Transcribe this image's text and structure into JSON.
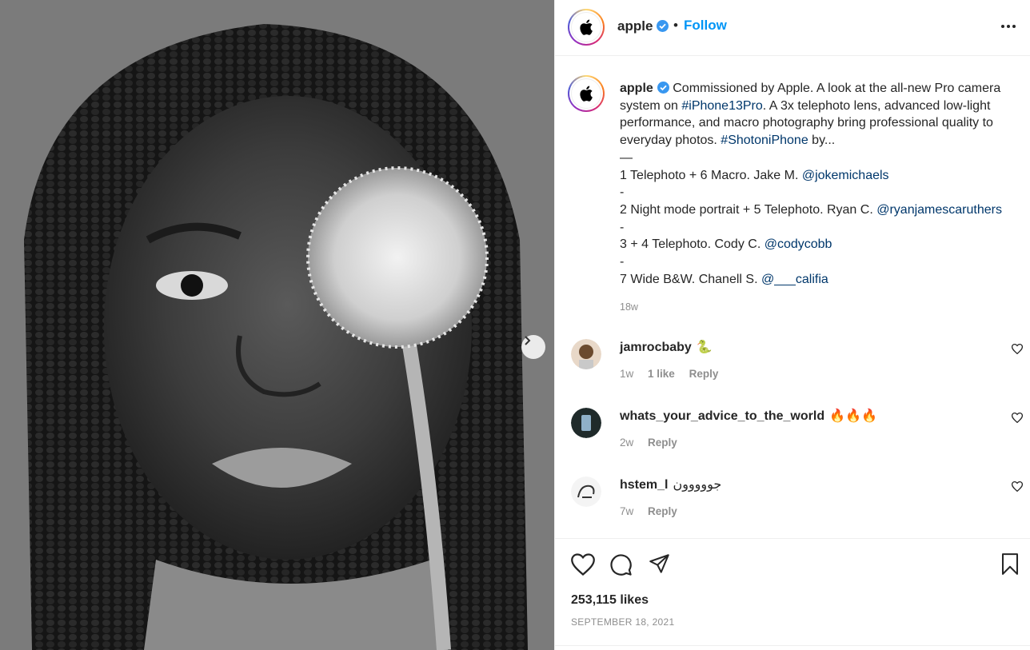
{
  "header": {
    "username": "apple",
    "separator": "•",
    "follow_label": "Follow"
  },
  "caption": {
    "username": "apple",
    "text_parts": {
      "p1": "Commissioned by Apple. A look at the all-new Pro camera system on ",
      "tag1": "#iPhone13Pro",
      "p2": ". A 3x telephoto lens, advanced low-light performance, and macro photography bring professional quality to everyday photos. ",
      "tag2": "#ShotoniPhone",
      "p3": " by..."
    },
    "lines": [
      {
        "text": "—",
        "mention": ""
      },
      {
        "text": "1 Telephoto + 6 Macro. Jake M. ",
        "mention": "@jokemichaels"
      },
      {
        "text": "-",
        "mention": ""
      },
      {
        "text": "2 Night mode portrait + 5 Telephoto. Ryan C. ",
        "mention": "@ryanjamescaruthers"
      },
      {
        "text": "-",
        "mention": ""
      },
      {
        "text": "3 + 4 Telephoto. Cody C. ",
        "mention": "@codycobb"
      },
      {
        "text": "-",
        "mention": ""
      },
      {
        "text": "7 Wide B&W. Chanell S. ",
        "mention": "@___califia"
      }
    ],
    "age": "18w"
  },
  "comments": [
    {
      "username": "jamrocbaby",
      "emoji": "🐍",
      "time": "1w",
      "likes": "1 like",
      "reply": "Reply"
    },
    {
      "username": "whats_your_advice_to_the_world",
      "emoji": "🔥🔥🔥",
      "time": "2w",
      "likes": "",
      "reply": "Reply"
    },
    {
      "username": "hstem_l",
      "emoji": "جووووون",
      "time": "7w",
      "likes": "",
      "reply": "Reply"
    }
  ],
  "footer": {
    "likes": "253,115 likes",
    "date": "SEPTEMBER 18, 2021"
  },
  "icons": [
    "apple-logo-icon",
    "verified-icon",
    "more-icon",
    "heart-icon",
    "comment-icon",
    "share-icon",
    "bookmark-icon",
    "chevron-right-icon"
  ],
  "colors": {
    "link": "#0095f6",
    "tag": "#00376b",
    "meta": "#8e8e8e"
  }
}
